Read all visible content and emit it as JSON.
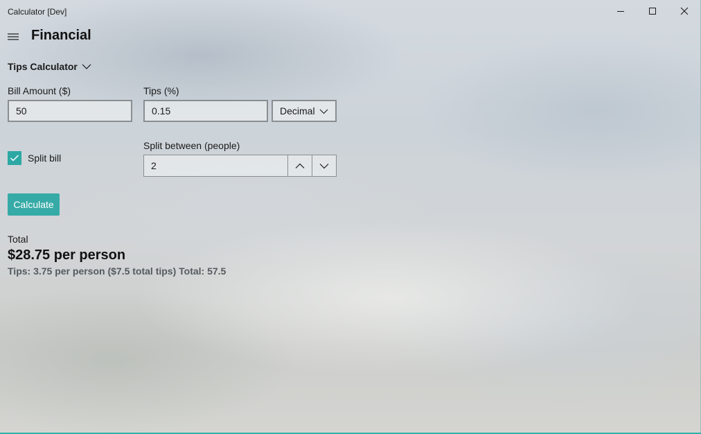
{
  "window": {
    "title": "Calculator [Dev]",
    "controls": [
      "minimize",
      "maximize",
      "close"
    ]
  },
  "header": {
    "menu_icon": "hamburger-menu-icon",
    "title": "Financial"
  },
  "calculator_mode": {
    "selected": "Tips Calculator",
    "icon": "chevron-down-icon"
  },
  "form": {
    "bill_amount": {
      "label": "Bill Amount ($)",
      "value": "50"
    },
    "tips": {
      "label": "Tips (%)",
      "value": "0.15",
      "format_selected": "Decimal"
    },
    "split_bill": {
      "label": "Split bill",
      "checked": true
    },
    "split_between": {
      "label": "Split between (people)",
      "value": "2"
    },
    "calculate_label": "Calculate"
  },
  "result": {
    "label": "Total",
    "per_person": "$28.75 per person",
    "detail": "Tips: 3.75 per person ($7.5 total tips) Total: 57.5"
  },
  "colors": {
    "accent": "#36aaa6",
    "checkbox": "#2ca8a4",
    "detail_text": "#555a5e"
  }
}
